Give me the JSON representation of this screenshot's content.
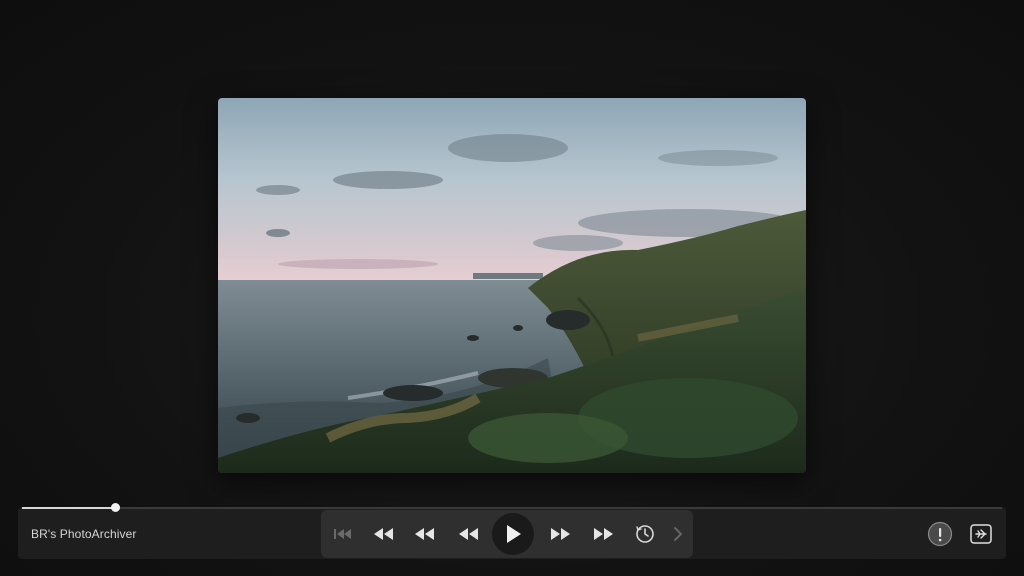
{
  "app": {
    "name": "BR's PhotoArchiver"
  },
  "playback": {
    "progress": 0.095,
    "state": "paused"
  },
  "photo": {
    "subject": "coastal cliffs at dusk"
  },
  "transport": {
    "buttons": [
      {
        "icon": "skip-to-start-icon",
        "enabled": false
      },
      {
        "icon": "fast-rewind-icon",
        "enabled": true
      },
      {
        "icon": "rewind-icon",
        "enabled": true
      },
      {
        "icon": "step-back-icon",
        "enabled": true
      },
      {
        "icon": "play-icon",
        "enabled": true
      },
      {
        "icon": "step-forward-icon",
        "enabled": true
      },
      {
        "icon": "fast-forward-icon",
        "enabled": true
      },
      {
        "icon": "history-icon",
        "enabled": true
      },
      {
        "icon": "chevron-right-icon",
        "enabled": false
      }
    ]
  },
  "right_controls": [
    {
      "icon": "info-icon"
    },
    {
      "icon": "airplane-mode-icon"
    }
  ],
  "colors": {
    "background": "#141414",
    "bar": "#1e1e1e",
    "transport": "#2f2f2f",
    "icon_active": "#e6e6e6",
    "icon_disabled": "#6a6a6a"
  }
}
